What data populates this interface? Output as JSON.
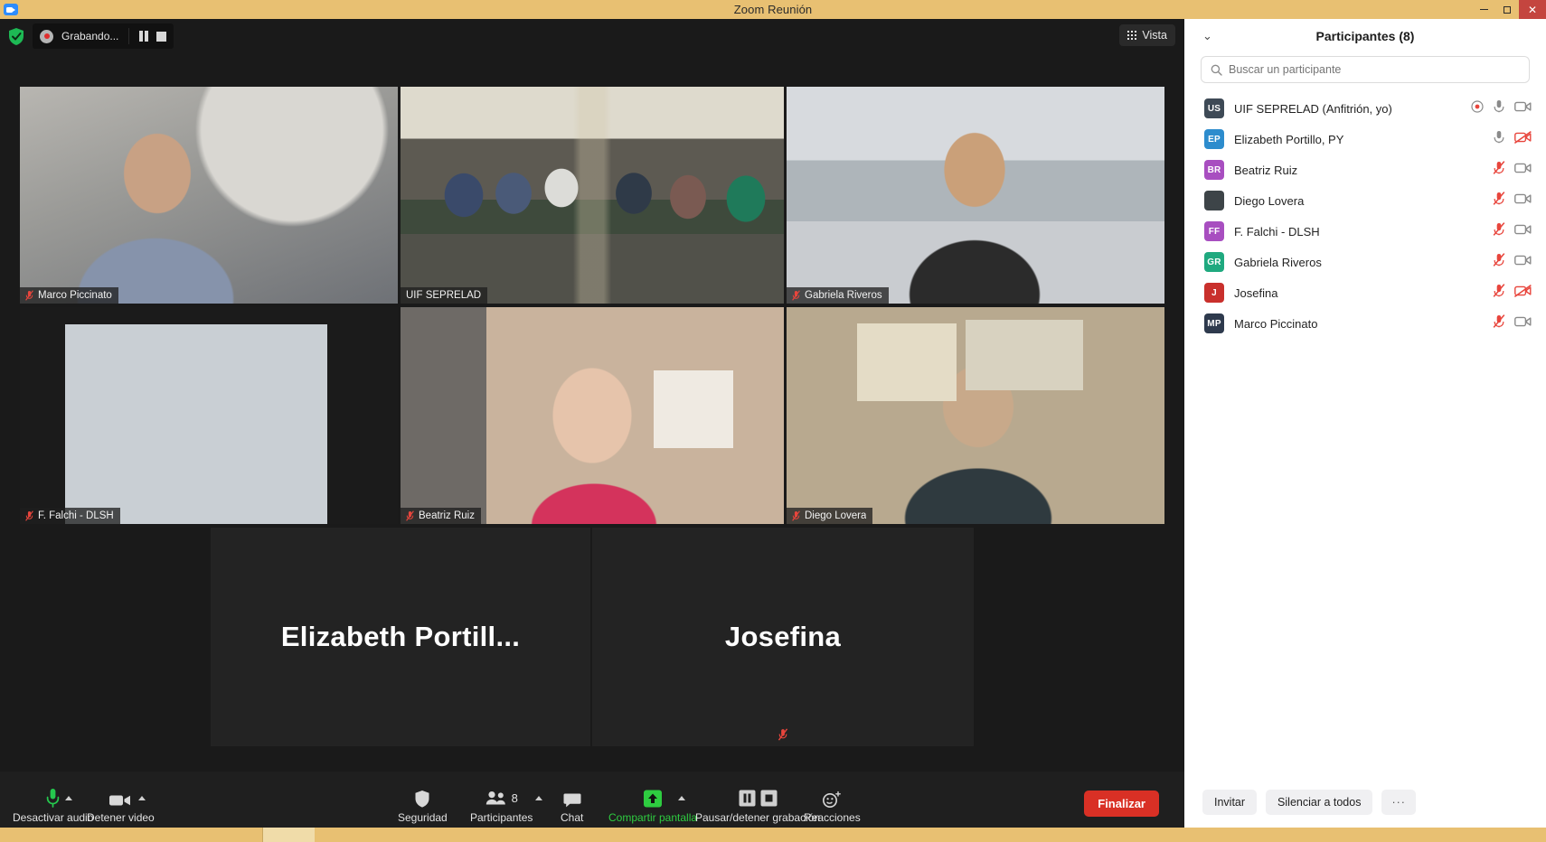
{
  "window": {
    "title": "Zoom Reunión",
    "minimize_label": "—",
    "maximize_label": "❐",
    "close_label": "✕"
  },
  "topbar": {
    "recording_label": "Grabando...",
    "pause_icon": "pause-icon",
    "stop_icon": "stop-icon",
    "shield_icon": "shield-check-icon",
    "record_icon": "record-dot-icon",
    "view_label": "Vista",
    "view_icon": "grid-icon"
  },
  "video_tiles": [
    {
      "name": "Marco Piccinato",
      "muted": true,
      "active": false,
      "kind": "video",
      "bg": "#8d93a3"
    },
    {
      "name": "UIF SEPRELAD",
      "muted": false,
      "active": true,
      "kind": "video",
      "bg": "#6b6352"
    },
    {
      "name": "Gabriela Riveros",
      "muted": true,
      "active": false,
      "kind": "video",
      "bg": "#bfc4c9"
    },
    {
      "name": "F. Falchi - DLSH",
      "muted": true,
      "active": false,
      "kind": "video",
      "bg": "#4f555c"
    },
    {
      "name": "Beatriz Ruiz",
      "muted": true,
      "active": false,
      "kind": "video",
      "bg": "#c3a392"
    },
    {
      "name": "Diego Lovera",
      "muted": true,
      "active": false,
      "kind": "video",
      "bg": "#6d6a63"
    }
  ],
  "placeholder_tiles": [
    {
      "name": "Elizabeth Portill...",
      "muted": false
    },
    {
      "name": "Josefina",
      "muted": true
    }
  ],
  "toolbar": {
    "audio_label": "Desactivar audio",
    "audio_icon": "microphone-icon",
    "video_label": "Detener video",
    "video_icon": "camera-icon",
    "security_label": "Seguridad",
    "security_icon": "shield-icon",
    "participants_label": "Participantes",
    "participants_icon": "people-icon",
    "participants_count": "8",
    "chat_label": "Chat",
    "chat_icon": "chat-bubble-icon",
    "share_label": "Compartir pantalla",
    "share_icon": "share-screen-up-arrow-icon",
    "record_label": "Pausar/detener grabación",
    "record_pause_icon": "pause-icon",
    "record_stop_icon": "stop-icon",
    "reactions_label": "Reacciones",
    "reactions_icon": "smiley-plus-icon",
    "end_label": "Finalizar",
    "accent_green": "#2ecc40",
    "end_red": "#d93025"
  },
  "participants_panel": {
    "title": "Participantes (8)",
    "collapse_icon": "chevron-down-icon",
    "search_placeholder": "Buscar un participante",
    "search_value": "",
    "search_icon": "search-icon",
    "rows": [
      {
        "initials": "US",
        "color": "#3e4a56",
        "name": "UIF SEPRELAD (Anfitrión, yo)",
        "host_badge": true,
        "mic": "on",
        "cam": "on"
      },
      {
        "initials": "EP",
        "color": "#2d8ccd",
        "name": "Elizabeth Portillo, PY",
        "host_badge": false,
        "mic": "on",
        "cam": "off"
      },
      {
        "initials": "BR",
        "color": "#a84ec0",
        "name": "Beatriz Ruiz",
        "host_badge": false,
        "mic": "off",
        "cam": "on"
      },
      {
        "initials": "",
        "color": "#3d4448",
        "name": "Diego Lovera",
        "host_badge": false,
        "mic": "off",
        "cam": "on"
      },
      {
        "initials": "FF",
        "color": "#a84ec0",
        "name": "F. Falchi - DLSH",
        "host_badge": false,
        "mic": "off",
        "cam": "on"
      },
      {
        "initials": "GR",
        "color": "#1fa97f",
        "name": "Gabriela Riveros",
        "host_badge": false,
        "mic": "off",
        "cam": "on"
      },
      {
        "initials": "J",
        "color": "#c9302c",
        "name": "Josefina",
        "host_badge": false,
        "mic": "off",
        "cam": "off"
      },
      {
        "initials": "MP",
        "color": "#2e3a4d",
        "name": "Marco Piccinato",
        "host_badge": false,
        "mic": "off",
        "cam": "on"
      }
    ],
    "footer": {
      "invite_label": "Invitar",
      "mute_all_label": "Silenciar a todos",
      "more_label": "···"
    }
  }
}
